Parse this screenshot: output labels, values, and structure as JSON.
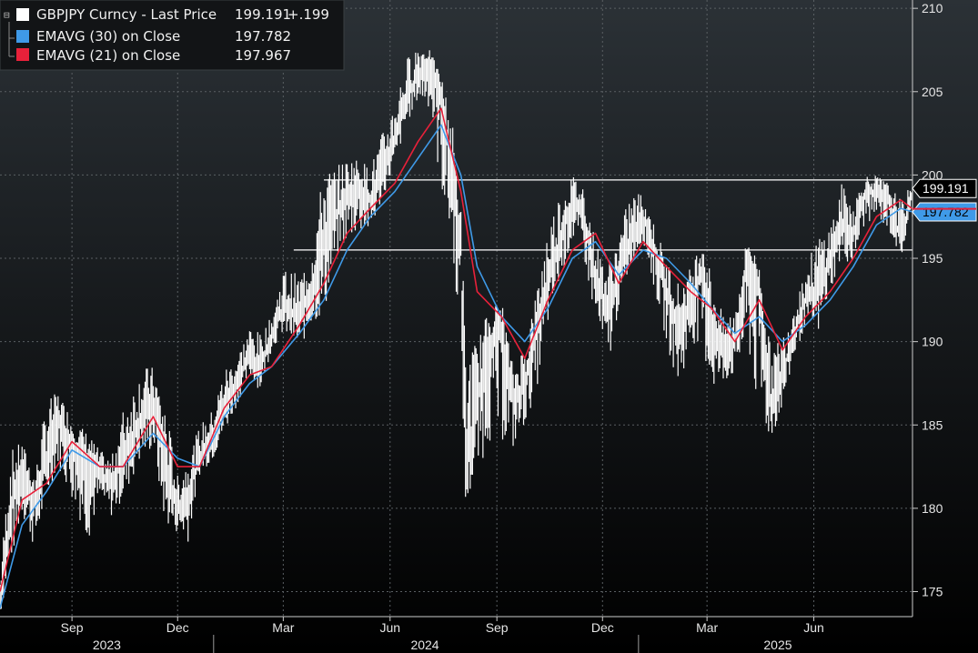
{
  "colors": {
    "background_top": "#2b3136",
    "background_bottom": "#000000",
    "grid": "#5a5f63",
    "price": "#ffffff",
    "ema30": "#3f9ae8",
    "ema21": "#e8213a",
    "level_line": "#ffffff",
    "legend_bg": "#121416"
  },
  "legend": {
    "rows": [
      {
        "label": "GBPJPY Curncy - Last Price",
        "value": "199.191",
        "change": "+.199",
        "swatch": "#ffffff"
      },
      {
        "label": "EMAVG (30)  on Close",
        "value": "197.782",
        "change": "",
        "swatch": "#3f9ae8"
      },
      {
        "label": "EMAVG (21)  on Close",
        "value": "197.967",
        "change": "",
        "swatch": "#e8213a"
      }
    ]
  },
  "last_value_tags": {
    "price": "199.191",
    "ema30": "197.782"
  },
  "chart_data": {
    "type": "line",
    "title": "",
    "xlabel": "",
    "ylabel": "",
    "ylim": [
      173.5,
      210.5
    ],
    "xlim": [
      "2023-07-01",
      "2025-08-25"
    ],
    "y_ticks": [
      "175",
      "180",
      "185",
      "190",
      "195",
      "200",
      "205",
      "210"
    ],
    "x_ticks": [
      {
        "label": "Sep",
        "date": "2023-09-01"
      },
      {
        "label": "Dec",
        "date": "2023-12-01"
      },
      {
        "label": "Mar",
        "date": "2024-03-01"
      },
      {
        "label": "Jun",
        "date": "2024-06-01"
      },
      {
        "label": "Sep",
        "date": "2024-09-01"
      },
      {
        "label": "Dec",
        "date": "2024-12-01"
      },
      {
        "label": "Mar",
        "date": "2025-03-01"
      },
      {
        "label": "Jun",
        "date": "2025-06-01"
      }
    ],
    "years": [
      {
        "label": "2023",
        "date": "2023-10-01"
      },
      {
        "label": "2024",
        "date": "2024-07-01"
      },
      {
        "label": "2025",
        "date": "2025-05-01"
      }
    ],
    "year_separators": [
      "2024-01-01",
      "2025-01-01"
    ],
    "grid": true,
    "legend": "top-left",
    "horizontal_levels": [
      {
        "value": 199.7,
        "from": "2024-04-05",
        "to": "2025-08-25"
      },
      {
        "value": 195.5,
        "from": "2024-03-10",
        "to": "2025-08-25"
      }
    ],
    "series": [
      {
        "name": "GBPJPY Curncy - Last Price",
        "style": "high-low bars",
        "x": [
          "2023-07-01",
          "2023-07-10",
          "2023-07-20",
          "2023-07-31",
          "2023-08-10",
          "2023-08-20",
          "2023-09-01",
          "2023-09-15",
          "2023-09-25",
          "2023-10-05",
          "2023-10-15",
          "2023-10-31",
          "2023-11-10",
          "2023-11-20",
          "2023-12-01",
          "2023-12-10",
          "2023-12-20",
          "2024-01-01",
          "2024-01-10",
          "2024-01-20",
          "2024-02-01",
          "2024-02-10",
          "2024-02-20",
          "2024-03-01",
          "2024-03-15",
          "2024-03-25",
          "2024-04-05",
          "2024-04-15",
          "2024-04-25",
          "2024-05-05",
          "2024-05-15",
          "2024-05-25",
          "2024-06-05",
          "2024-06-15",
          "2024-06-25",
          "2024-07-05",
          "2024-07-15",
          "2024-07-25",
          "2024-08-01",
          "2024-08-05",
          "2024-08-15",
          "2024-08-25",
          "2024-09-05",
          "2024-09-15",
          "2024-09-25",
          "2024-10-05",
          "2024-10-15",
          "2024-10-25",
          "2024-11-05",
          "2024-11-15",
          "2024-11-25",
          "2024-12-05",
          "2024-12-15",
          "2024-12-25",
          "2025-01-05",
          "2025-01-15",
          "2025-01-25",
          "2025-02-05",
          "2025-02-15",
          "2025-02-25",
          "2025-03-05",
          "2025-03-15",
          "2025-03-25",
          "2025-04-05",
          "2025-04-15",
          "2025-04-25",
          "2025-05-05",
          "2025-05-15",
          "2025-05-25",
          "2025-06-05",
          "2025-06-15",
          "2025-06-25",
          "2025-07-05",
          "2025-07-15",
          "2025-07-25",
          "2025-08-05",
          "2025-08-15",
          "2025-08-25"
        ],
        "y": [
          174.5,
          180.0,
          182.5,
          180.5,
          183.0,
          185.5,
          184.0,
          183.0,
          182.0,
          181.5,
          183.0,
          185.5,
          186.5,
          182.5,
          180.0,
          181.0,
          183.0,
          184.5,
          186.0,
          187.5,
          189.0,
          188.5,
          190.5,
          192.0,
          191.5,
          193.0,
          196.0,
          197.5,
          199.0,
          199.5,
          198.5,
          200.0,
          202.0,
          204.5,
          206.0,
          207.0,
          205.0,
          200.0,
          196.0,
          182.0,
          186.5,
          190.0,
          191.0,
          186.5,
          187.5,
          190.5,
          193.5,
          196.0,
          198.5,
          197.5,
          194.0,
          192.0,
          194.0,
          196.0,
          197.5,
          195.5,
          193.0,
          191.0,
          192.5,
          194.5,
          191.0,
          189.5,
          190.0,
          195.0,
          193.5,
          186.5,
          188.0,
          190.5,
          192.5,
          193.0,
          195.0,
          197.0,
          196.5,
          199.0,
          199.0,
          198.5,
          196.0,
          199.191
        ],
        "low": [
          173.5,
          176.5,
          179.5,
          177.5,
          180.5,
          182.5,
          180.5,
          178.0,
          180.5,
          179.5,
          180.5,
          183.0,
          183.5,
          179.0,
          178.5,
          178.0,
          182.0,
          183.0,
          184.5,
          186.0,
          188.0,
          187.0,
          189.5,
          190.5,
          189.5,
          191.0,
          191.5,
          195.0,
          196.0,
          196.5,
          196.5,
          198.5,
          200.5,
          203.0,
          204.5,
          204.0,
          199.0,
          195.0,
          190.0,
          180.0,
          182.0,
          184.0,
          184.0,
          183.5,
          185.0,
          187.0,
          191.0,
          193.5,
          196.0,
          195.0,
          191.0,
          188.0,
          192.0,
          194.5,
          196.0,
          193.0,
          190.0,
          187.0,
          190.0,
          189.5,
          187.0,
          187.5,
          188.0,
          189.5,
          185.0,
          184.0,
          186.0,
          189.0,
          191.0,
          190.5,
          193.0,
          195.0,
          194.5,
          197.0,
          197.5,
          196.5,
          195.0,
          197.5
        ],
        "high": [
          176.0,
          183.5,
          184.0,
          182.0,
          186.5,
          187.0,
          185.5,
          184.5,
          183.5,
          183.0,
          186.0,
          188.5,
          188.5,
          186.5,
          182.0,
          183.0,
          185.0,
          186.0,
          188.5,
          189.0,
          191.0,
          190.5,
          191.5,
          194.5,
          194.0,
          195.5,
          200.5,
          200.5,
          201.0,
          201.0,
          200.5,
          202.5,
          204.5,
          207.0,
          208.0,
          207.5,
          206.0,
          203.0,
          198.0,
          190.0,
          190.0,
          192.0,
          192.5,
          188.5,
          190.0,
          193.0,
          197.0,
          199.0,
          200.0,
          199.5,
          196.0,
          194.5,
          196.5,
          199.0,
          199.0,
          197.0,
          195.0,
          193.5,
          194.5,
          196.5,
          194.0,
          191.5,
          192.0,
          196.5,
          194.5,
          189.5,
          190.5,
          192.5,
          194.5,
          196.5,
          197.0,
          199.5,
          198.5,
          200.0,
          200.0,
          199.5,
          198.5,
          199.5
        ]
      },
      {
        "name": "EMAVG (30)  on Close",
        "x": [
          "2023-07-01",
          "2023-07-20",
          "2023-08-10",
          "2023-09-01",
          "2023-09-25",
          "2023-10-15",
          "2023-11-10",
          "2023-12-01",
          "2023-12-20",
          "2024-01-10",
          "2024-02-01",
          "2024-02-20",
          "2024-03-15",
          "2024-04-05",
          "2024-04-25",
          "2024-05-15",
          "2024-06-05",
          "2024-06-25",
          "2024-07-15",
          "2024-08-01",
          "2024-08-15",
          "2024-09-05",
          "2024-09-25",
          "2024-10-15",
          "2024-11-05",
          "2024-11-25",
          "2024-12-15",
          "2025-01-05",
          "2025-01-25",
          "2025-02-15",
          "2025-03-05",
          "2025-03-25",
          "2025-04-15",
          "2025-05-05",
          "2025-05-25",
          "2025-06-15",
          "2025-07-05",
          "2025-07-25",
          "2025-08-15",
          "2025-08-25"
        ],
        "values": [
          174.0,
          179.0,
          181.0,
          183.5,
          182.5,
          182.5,
          184.5,
          183.0,
          182.5,
          185.5,
          187.5,
          188.5,
          190.5,
          192.5,
          195.5,
          197.5,
          199.0,
          201.0,
          203.0,
          200.0,
          194.5,
          191.5,
          190.0,
          192.0,
          195.0,
          196.0,
          194.0,
          195.5,
          195.0,
          193.5,
          192.0,
          190.5,
          191.5,
          190.0,
          191.0,
          192.5,
          194.5,
          197.0,
          198.0,
          197.782
        ]
      },
      {
        "name": "EMAVG (21)  on Close",
        "x": [
          "2023-07-01",
          "2023-07-20",
          "2023-08-10",
          "2023-09-01",
          "2023-09-25",
          "2023-10-15",
          "2023-11-10",
          "2023-12-01",
          "2023-12-20",
          "2024-01-10",
          "2024-02-01",
          "2024-02-20",
          "2024-03-15",
          "2024-04-05",
          "2024-04-25",
          "2024-05-15",
          "2024-06-05",
          "2024-06-25",
          "2024-07-15",
          "2024-08-01",
          "2024-08-15",
          "2024-09-05",
          "2024-09-25",
          "2024-10-15",
          "2024-11-05",
          "2024-11-25",
          "2024-12-15",
          "2025-01-05",
          "2025-01-25",
          "2025-02-15",
          "2025-03-05",
          "2025-03-25",
          "2025-04-15",
          "2025-05-05",
          "2025-05-25",
          "2025-06-15",
          "2025-07-05",
          "2025-07-25",
          "2025-08-15",
          "2025-08-25"
        ],
        "values": [
          175.0,
          180.5,
          181.5,
          184.0,
          182.5,
          182.5,
          185.5,
          182.5,
          182.5,
          186.0,
          188.0,
          188.5,
          191.0,
          193.5,
          196.5,
          198.0,
          199.5,
          202.0,
          204.0,
          199.0,
          193.0,
          191.5,
          189.0,
          192.5,
          195.5,
          196.5,
          193.5,
          196.0,
          194.5,
          193.0,
          192.0,
          190.0,
          192.5,
          189.5,
          191.5,
          193.0,
          195.0,
          197.5,
          198.5,
          197.967
        ]
      }
    ]
  }
}
